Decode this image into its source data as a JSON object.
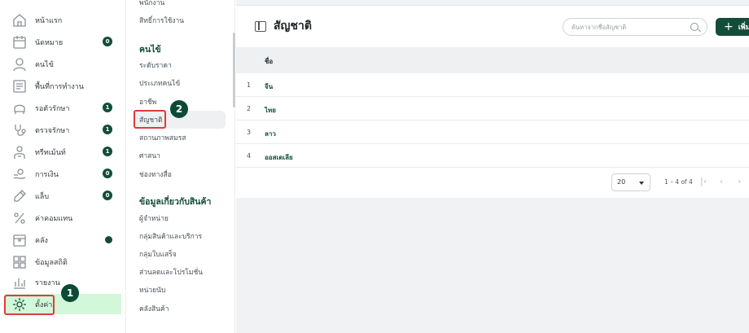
{
  "sidebar": {
    "items": [
      {
        "label": "หน้าแรก",
        "icon": "home-icon"
      },
      {
        "label": "นัดหมาย",
        "icon": "calendar-icon",
        "badge": "0"
      },
      {
        "label": "คนไข้",
        "icon": "user-icon"
      },
      {
        "label": "พื้นที่การทำงาน",
        "icon": "workspace-icon"
      },
      {
        "label": "รอตัวรักษา",
        "icon": "chair-icon",
        "badge": "1"
      },
      {
        "label": "ตรวจรักษา",
        "icon": "stethoscope-icon",
        "badge": "1"
      },
      {
        "label": "ทรีทเม้นท์",
        "icon": "treatment-icon",
        "badge": "1"
      },
      {
        "label": "การเงิน",
        "icon": "money-icon",
        "badge": "0"
      },
      {
        "label": "แล็บ",
        "icon": "lab-icon",
        "badge": "0"
      },
      {
        "label": "ค่าคอมแทน",
        "icon": "percent-icon"
      },
      {
        "label": "คลัง",
        "icon": "box-icon",
        "dot": true
      },
      {
        "label": "ข้อมูลสถิติ",
        "icon": "grid-icon"
      },
      {
        "label": "รายงาน",
        "icon": "report-icon"
      },
      {
        "label": "ตั้งค่า",
        "icon": "gear-icon",
        "active": true
      }
    ]
  },
  "settings_menu": {
    "top_cut": "พนักงาน",
    "item_permissions": "สิทธิ์การใช้งาน",
    "section_patient": "คนไข้",
    "patient_items": [
      "ระดับราคา",
      "ประเภทคนไข้",
      "อาชีพ",
      "สัญชาติ",
      "สถานภาพสมรส",
      "ศาสนา",
      "ช่องทางสื่อ"
    ],
    "section_product": "ข้อมูลเกี่ยวกับสินค้า",
    "product_items": [
      "ผู้จำหน่าย",
      "กลุ่มสินค้าและบริการ",
      "กลุ่มใบแสร็จ",
      "ส่วนลดและโปรโมชั่น",
      "หน่วยนับ",
      "คลังสินค้า"
    ]
  },
  "header": {
    "title": "สัญชาติ",
    "search_placeholder": "ค้นหาจากชื่อสัญชาติ",
    "add_label": "เพิ่ม"
  },
  "table": {
    "column_name": "ชื่อ",
    "rows": [
      {
        "num": "1",
        "name": "จีน"
      },
      {
        "num": "2",
        "name": "ไทย"
      },
      {
        "num": "3",
        "name": "ลาว"
      },
      {
        "num": "4",
        "name": "ออสเตเลีย"
      }
    ]
  },
  "pagination": {
    "page_size": "20",
    "range": "1 – 4 of 4",
    "first": "|‹",
    "prev": "‹",
    "next": "›"
  },
  "annotations": {
    "step1": "1",
    "step2": "2",
    "color": "#e03b3b"
  },
  "colors": {
    "brand": "#124d3a",
    "active_bg": "#d3f7d9"
  }
}
